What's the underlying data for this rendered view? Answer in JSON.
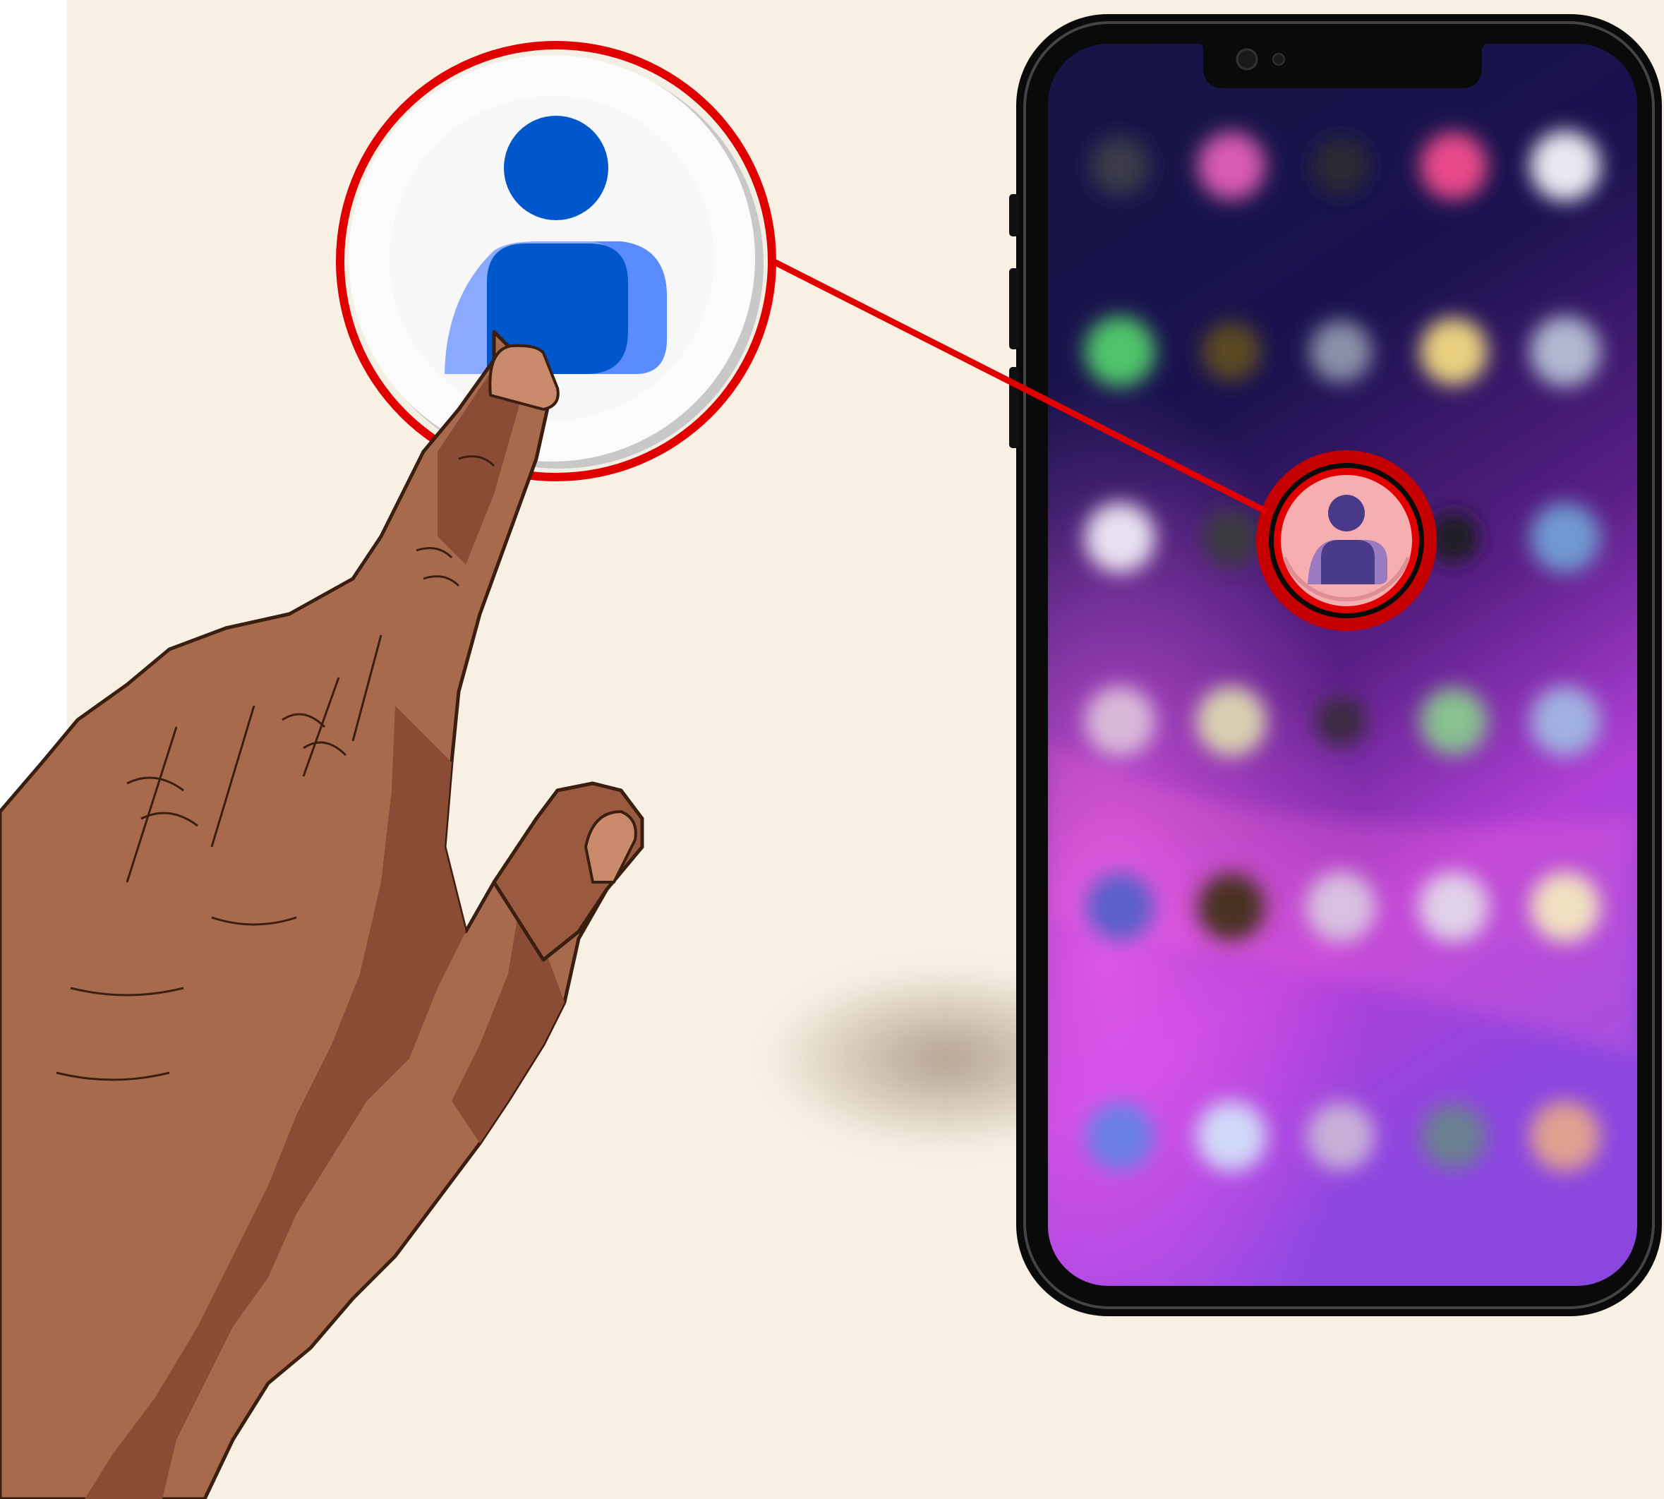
{
  "scene": {
    "description_icon": "contacts-app-icon",
    "background_color": "#f8f1e3",
    "callout_color": "#e00000",
    "icon_blue_dark": "#0057cc",
    "icon_blue_light": "#8aaaff",
    "icon_blue_mid": "#5a8cff",
    "phone_frame_color": "#0a0a0a",
    "highlight_pink": "#f6aeb0",
    "skin_color": "#a86a4c"
  },
  "phone": {
    "app_grid_rows": 6,
    "app_grid_cols": 5,
    "highlighted_app": "contacts-icon"
  }
}
